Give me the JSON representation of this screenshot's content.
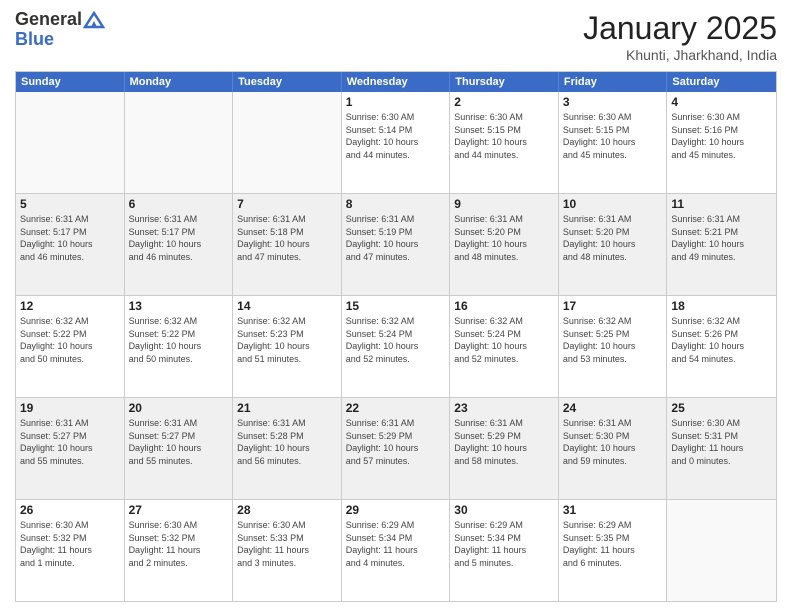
{
  "header": {
    "logo_general": "General",
    "logo_blue": "Blue",
    "month_title": "January 2025",
    "location": "Khunti, Jharkhand, India"
  },
  "weekdays": [
    "Sunday",
    "Monday",
    "Tuesday",
    "Wednesday",
    "Thursday",
    "Friday",
    "Saturday"
  ],
  "rows": [
    {
      "shaded": false,
      "cells": [
        {
          "date": "",
          "info": ""
        },
        {
          "date": "",
          "info": ""
        },
        {
          "date": "",
          "info": ""
        },
        {
          "date": "1",
          "info": "Sunrise: 6:30 AM\nSunset: 5:14 PM\nDaylight: 10 hours\nand 44 minutes."
        },
        {
          "date": "2",
          "info": "Sunrise: 6:30 AM\nSunset: 5:15 PM\nDaylight: 10 hours\nand 44 minutes."
        },
        {
          "date": "3",
          "info": "Sunrise: 6:30 AM\nSunset: 5:15 PM\nDaylight: 10 hours\nand 45 minutes."
        },
        {
          "date": "4",
          "info": "Sunrise: 6:30 AM\nSunset: 5:16 PM\nDaylight: 10 hours\nand 45 minutes."
        }
      ]
    },
    {
      "shaded": true,
      "cells": [
        {
          "date": "5",
          "info": "Sunrise: 6:31 AM\nSunset: 5:17 PM\nDaylight: 10 hours\nand 46 minutes."
        },
        {
          "date": "6",
          "info": "Sunrise: 6:31 AM\nSunset: 5:17 PM\nDaylight: 10 hours\nand 46 minutes."
        },
        {
          "date": "7",
          "info": "Sunrise: 6:31 AM\nSunset: 5:18 PM\nDaylight: 10 hours\nand 47 minutes."
        },
        {
          "date": "8",
          "info": "Sunrise: 6:31 AM\nSunset: 5:19 PM\nDaylight: 10 hours\nand 47 minutes."
        },
        {
          "date": "9",
          "info": "Sunrise: 6:31 AM\nSunset: 5:20 PM\nDaylight: 10 hours\nand 48 minutes."
        },
        {
          "date": "10",
          "info": "Sunrise: 6:31 AM\nSunset: 5:20 PM\nDaylight: 10 hours\nand 48 minutes."
        },
        {
          "date": "11",
          "info": "Sunrise: 6:31 AM\nSunset: 5:21 PM\nDaylight: 10 hours\nand 49 minutes."
        }
      ]
    },
    {
      "shaded": false,
      "cells": [
        {
          "date": "12",
          "info": "Sunrise: 6:32 AM\nSunset: 5:22 PM\nDaylight: 10 hours\nand 50 minutes."
        },
        {
          "date": "13",
          "info": "Sunrise: 6:32 AM\nSunset: 5:22 PM\nDaylight: 10 hours\nand 50 minutes."
        },
        {
          "date": "14",
          "info": "Sunrise: 6:32 AM\nSunset: 5:23 PM\nDaylight: 10 hours\nand 51 minutes."
        },
        {
          "date": "15",
          "info": "Sunrise: 6:32 AM\nSunset: 5:24 PM\nDaylight: 10 hours\nand 52 minutes."
        },
        {
          "date": "16",
          "info": "Sunrise: 6:32 AM\nSunset: 5:24 PM\nDaylight: 10 hours\nand 52 minutes."
        },
        {
          "date": "17",
          "info": "Sunrise: 6:32 AM\nSunset: 5:25 PM\nDaylight: 10 hours\nand 53 minutes."
        },
        {
          "date": "18",
          "info": "Sunrise: 6:32 AM\nSunset: 5:26 PM\nDaylight: 10 hours\nand 54 minutes."
        }
      ]
    },
    {
      "shaded": true,
      "cells": [
        {
          "date": "19",
          "info": "Sunrise: 6:31 AM\nSunset: 5:27 PM\nDaylight: 10 hours\nand 55 minutes."
        },
        {
          "date": "20",
          "info": "Sunrise: 6:31 AM\nSunset: 5:27 PM\nDaylight: 10 hours\nand 55 minutes."
        },
        {
          "date": "21",
          "info": "Sunrise: 6:31 AM\nSunset: 5:28 PM\nDaylight: 10 hours\nand 56 minutes."
        },
        {
          "date": "22",
          "info": "Sunrise: 6:31 AM\nSunset: 5:29 PM\nDaylight: 10 hours\nand 57 minutes."
        },
        {
          "date": "23",
          "info": "Sunrise: 6:31 AM\nSunset: 5:29 PM\nDaylight: 10 hours\nand 58 minutes."
        },
        {
          "date": "24",
          "info": "Sunrise: 6:31 AM\nSunset: 5:30 PM\nDaylight: 10 hours\nand 59 minutes."
        },
        {
          "date": "25",
          "info": "Sunrise: 6:30 AM\nSunset: 5:31 PM\nDaylight: 11 hours\nand 0 minutes."
        }
      ]
    },
    {
      "shaded": false,
      "cells": [
        {
          "date": "26",
          "info": "Sunrise: 6:30 AM\nSunset: 5:32 PM\nDaylight: 11 hours\nand 1 minute."
        },
        {
          "date": "27",
          "info": "Sunrise: 6:30 AM\nSunset: 5:32 PM\nDaylight: 11 hours\nand 2 minutes."
        },
        {
          "date": "28",
          "info": "Sunrise: 6:30 AM\nSunset: 5:33 PM\nDaylight: 11 hours\nand 3 minutes."
        },
        {
          "date": "29",
          "info": "Sunrise: 6:29 AM\nSunset: 5:34 PM\nDaylight: 11 hours\nand 4 minutes."
        },
        {
          "date": "30",
          "info": "Sunrise: 6:29 AM\nSunset: 5:34 PM\nDaylight: 11 hours\nand 5 minutes."
        },
        {
          "date": "31",
          "info": "Sunrise: 6:29 AM\nSunset: 5:35 PM\nDaylight: 11 hours\nand 6 minutes."
        },
        {
          "date": "",
          "info": ""
        }
      ]
    }
  ]
}
